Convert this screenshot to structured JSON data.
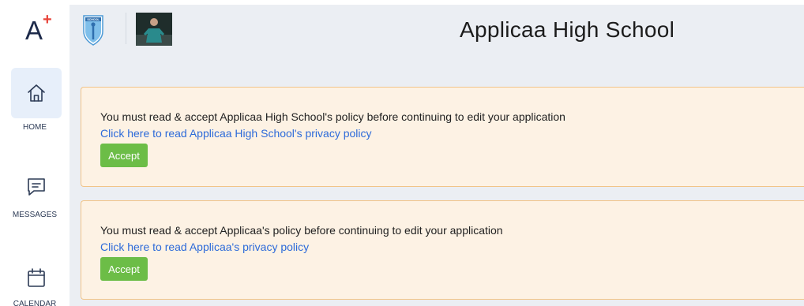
{
  "app": {
    "logo_letter": "A",
    "logo_plus": "+"
  },
  "sidebar": {
    "items": [
      {
        "label": "HOME",
        "icon": "home-icon",
        "active": true
      },
      {
        "label": "MESSAGES",
        "icon": "message-icon",
        "active": false
      },
      {
        "label": "CALENDAR",
        "icon": "calendar-icon",
        "active": false
      }
    ]
  },
  "header": {
    "crest_text": "SCHOOL",
    "title": "Applicaa High School"
  },
  "notices": [
    {
      "message": "You must read & accept Applicaa High School's policy before continuing to edit your application",
      "link": "Click here to read Applicaa High School's privacy policy",
      "button": "Accept"
    },
    {
      "message": "You must read & accept Applicaa's policy before continuing to edit your application",
      "link": "Click here to read Applicaa's privacy policy",
      "button": "Accept"
    }
  ],
  "colors": {
    "accent": "#6cbd47",
    "link": "#2d6ad9",
    "notice_bg": "#fdf2e4",
    "notice_border": "#f1c488",
    "logo_plus": "#e8443a"
  }
}
